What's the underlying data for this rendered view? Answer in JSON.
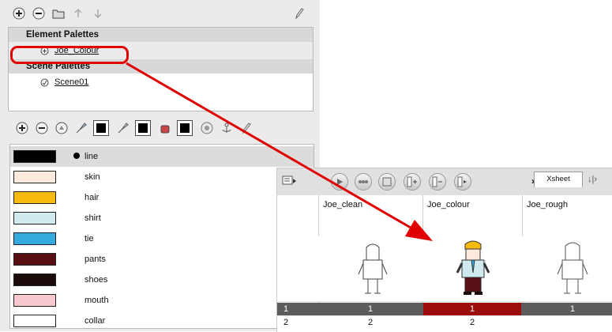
{
  "palette_panel": {
    "element_palettes_header": "Element Palettes",
    "element_palettes": [
      {
        "label": "Joe_Colour"
      }
    ],
    "scene_palettes_header": "Scene Palettes",
    "scene_palettes": [
      {
        "label": "Scene01"
      }
    ]
  },
  "colors": [
    {
      "name": "line",
      "hex": "#000000",
      "selected": true
    },
    {
      "name": "skin",
      "hex": "#fde9dd"
    },
    {
      "name": "hair",
      "hex": "#f7bb10"
    },
    {
      "name": "shirt",
      "hex": "#cfe9ee"
    },
    {
      "name": "tie",
      "hex": "#34aade"
    },
    {
      "name": "pants",
      "hex": "#5a0f14"
    },
    {
      "name": "shoes",
      "hex": "#1c0b0b"
    },
    {
      "name": "mouth",
      "hex": "#f7c8cf"
    },
    {
      "name": "collar",
      "hex": "#ffffff"
    }
  ],
  "xsheet": {
    "tab_label": "Xsheet",
    "more_label": "»",
    "columns": [
      {
        "name": "Joe_clean"
      },
      {
        "name": "Joe_colour"
      },
      {
        "name": "Joe_rough"
      }
    ],
    "rows": [
      {
        "number": "1",
        "values": [
          "1",
          "1",
          "1"
        ]
      },
      {
        "number": "2",
        "values": [
          "2",
          "2",
          ""
        ]
      }
    ]
  },
  "accent": {
    "highlight": "#e00000",
    "selected_cell": "#9b0d0d"
  }
}
